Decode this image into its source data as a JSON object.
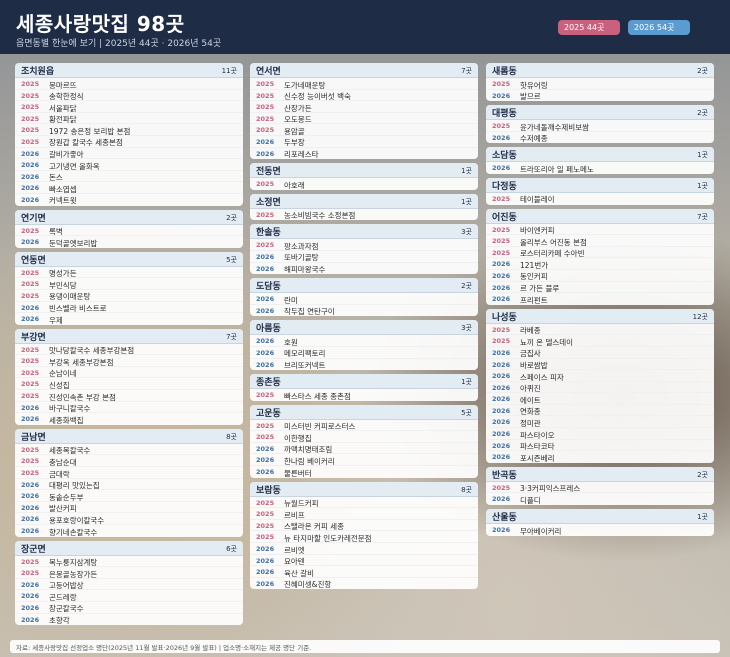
{
  "header": {
    "title": "세종사랑맛집 98곳",
    "subtitle": "읍면동별 한눈에 보기 | 2025년 44곳 · 2026년 54곳",
    "badge_2025": "2025 44곳",
    "badge_2026": "2026 54곳"
  },
  "colors": {
    "header_bg": "#1e2c45",
    "year_2025": "#c8607e",
    "year_2026": "#3d6fa6",
    "badge_2026": "#5b9bd0"
  },
  "columns": [
    [
      {
        "name": "조치원읍",
        "count": "11곳",
        "items": [
          {
            "year": "2025",
            "name": "몽마르뜨"
          },
          {
            "year": "2025",
            "name": "송학한정식"
          },
          {
            "year": "2025",
            "name": "서울파닭"
          },
          {
            "year": "2025",
            "name": "황전파닭"
          },
          {
            "year": "2025",
            "name": "1972 송은정 보리밥 본점"
          },
          {
            "year": "2025",
            "name": "장원갑 칼국수 세종본점"
          },
          {
            "year": "2026",
            "name": "갈비가좋아"
          },
          {
            "year": "2026",
            "name": "고기냉면 올화옥"
          },
          {
            "year": "2026",
            "name": "돈스"
          },
          {
            "year": "2026",
            "name": "빠소엽셉"
          },
          {
            "year": "2026",
            "name": "커넥트윗"
          }
        ]
      },
      {
        "name": "연기면",
        "count": "2곳",
        "items": [
          {
            "year": "2025",
            "name": "록벽"
          },
          {
            "year": "2026",
            "name": "둔덕골옛보리밥"
          }
        ]
      },
      {
        "name": "연동면",
        "count": "5곳",
        "items": [
          {
            "year": "2025",
            "name": "명성가든"
          },
          {
            "year": "2025",
            "name": "부민식당"
          },
          {
            "year": "2025",
            "name": "용댕이매운탕"
          },
          {
            "year": "2026",
            "name": "빈스벨라 비스트로"
          },
          {
            "year": "2026",
            "name": "우제"
          }
        ]
      },
      {
        "name": "부강면",
        "count": "7곳",
        "items": [
          {
            "year": "2025",
            "name": "맛나당칼국수 세종부강본점"
          },
          {
            "year": "2025",
            "name": "부강옥 세종부강본점"
          },
          {
            "year": "2025",
            "name": "순남이네"
          },
          {
            "year": "2025",
            "name": "신성집"
          },
          {
            "year": "2025",
            "name": "진성민속촌 부강 본점"
          },
          {
            "year": "2026",
            "name": "바구니칼국수"
          },
          {
            "year": "2026",
            "name": "세종화백집"
          }
        ]
      },
      {
        "name": "금남면",
        "count": "8곳",
        "items": [
          {
            "year": "2025",
            "name": "세종복칼국수"
          },
          {
            "year": "2025",
            "name": "충남순대"
          },
          {
            "year": "2025",
            "name": "금대락"
          },
          {
            "year": "2026",
            "name": "대평리 맛있는집"
          },
          {
            "year": "2026",
            "name": "동솥순두부"
          },
          {
            "year": "2026",
            "name": "발산커피"
          },
          {
            "year": "2026",
            "name": "용포호랑이칼국수"
          },
          {
            "year": "2026",
            "name": "향기네손칼국수"
          }
        ]
      },
      {
        "name": "장군면",
        "count": "6곳",
        "items": [
          {
            "year": "2025",
            "name": "복누룽지삼계탕"
          },
          {
            "year": "2025",
            "name": "은몽골농장가든"
          },
          {
            "year": "2026",
            "name": "고등어밥상"
          },
          {
            "year": "2026",
            "name": "곤드레랑"
          },
          {
            "year": "2026",
            "name": "장군칼국수"
          },
          {
            "year": "2026",
            "name": "초향각"
          }
        ]
      }
    ],
    [
      {
        "name": "연서면",
        "count": "7곳",
        "items": [
          {
            "year": "2025",
            "name": "도가네매운탕"
          },
          {
            "year": "2025",
            "name": "신수정 능이버섯 백숙"
          },
          {
            "year": "2025",
            "name": "산장가든"
          },
          {
            "year": "2025",
            "name": "오도몽드"
          },
          {
            "year": "2025",
            "name": "용암골"
          },
          {
            "year": "2026",
            "name": "두부장"
          },
          {
            "year": "2026",
            "name": "리포레스타"
          }
        ]
      },
      {
        "name": "전동면",
        "count": "1곳",
        "items": [
          {
            "year": "2025",
            "name": "아호래"
          }
        ]
      },
      {
        "name": "소정면",
        "count": "1곳",
        "items": [
          {
            "year": "2025",
            "name": "농소비빔국수 소정본점"
          }
        ]
      },
      {
        "name": "한솔동",
        "count": "3곳",
        "items": [
          {
            "year": "2025",
            "name": "팡소과자점"
          },
          {
            "year": "2026",
            "name": "또바기골탕"
          },
          {
            "year": "2026",
            "name": "해피마왕국수"
          }
        ]
      },
      {
        "name": "도담동",
        "count": "2곳",
        "items": [
          {
            "year": "2026",
            "name": "란미"
          },
          {
            "year": "2026",
            "name": "작두집 연탄구이"
          }
        ]
      },
      {
        "name": "아름동",
        "count": "3곳",
        "items": [
          {
            "year": "2026",
            "name": "호원"
          },
          {
            "year": "2026",
            "name": "메모리팩토리"
          },
          {
            "year": "2026",
            "name": "브리또커넥트"
          }
        ]
      },
      {
        "name": "종촌동",
        "count": "1곳",
        "items": [
          {
            "year": "2025",
            "name": "빠스타스 세종 종촌점"
          }
        ]
      },
      {
        "name": "고운동",
        "count": "5곳",
        "items": [
          {
            "year": "2025",
            "name": "미스터빈 커피로스터스"
          },
          {
            "year": "2025",
            "name": "이한행집"
          },
          {
            "year": "2026",
            "name": "까맥치명태조림"
          },
          {
            "year": "2026",
            "name": "한나림 베이커리"
          },
          {
            "year": "2026",
            "name": "물른버터"
          }
        ]
      },
      {
        "name": "보람동",
        "count": "8곳",
        "items": [
          {
            "year": "2025",
            "name": "뉴월드커피"
          },
          {
            "year": "2025",
            "name": "르비프"
          },
          {
            "year": "2025",
            "name": "스탤라온 커피 세종"
          },
          {
            "year": "2025",
            "name": "뉴 타지마할 인도카레전문점"
          },
          {
            "year": "2026",
            "name": "르비엣"
          },
          {
            "year": "2026",
            "name": "요아텐"
          },
          {
            "year": "2026",
            "name": "육산 갈비"
          },
          {
            "year": "2026",
            "name": "진혜미셍&진항"
          }
        ]
      }
    ],
    [
      {
        "name": "새롬동",
        "count": "2곳",
        "items": [
          {
            "year": "2025",
            "name": "핫유어링"
          },
          {
            "year": "2026",
            "name": "발므르"
          }
        ]
      },
      {
        "name": "대평동",
        "count": "2곳",
        "items": [
          {
            "year": "2025",
            "name": "윤가네돌깨수제비보쌈"
          },
          {
            "year": "2026",
            "name": "수저예종"
          }
        ]
      },
      {
        "name": "소담동",
        "count": "1곳",
        "items": [
          {
            "year": "2026",
            "name": "트라또리아 일 페노메노"
          }
        ]
      },
      {
        "name": "다정동",
        "count": "1곳",
        "items": [
          {
            "year": "2025",
            "name": "테이블레이"
          }
        ]
      },
      {
        "name": "어진동",
        "count": "7곳",
        "items": [
          {
            "year": "2025",
            "name": "바이엔커피"
          },
          {
            "year": "2025",
            "name": "올리부스 어진동 본점"
          },
          {
            "year": "2025",
            "name": "로스터리카페 수아빈"
          },
          {
            "year": "2026",
            "name": "121번가"
          },
          {
            "year": "2026",
            "name": "동인커피"
          },
          {
            "year": "2026",
            "name": "르 가든 블루"
          },
          {
            "year": "2026",
            "name": "프리펀트"
          }
        ]
      },
      {
        "name": "나성동",
        "count": "12곳",
        "items": [
          {
            "year": "2025",
            "name": "라베종"
          },
          {
            "year": "2025",
            "name": "뇨끼 온 델스데이"
          },
          {
            "year": "2026",
            "name": "금집사"
          },
          {
            "year": "2026",
            "name": "바로쌈밥"
          },
          {
            "year": "2026",
            "name": "스페이스 피자"
          },
          {
            "year": "2026",
            "name": "아퀴진"
          },
          {
            "year": "2026",
            "name": "에이트"
          },
          {
            "year": "2026",
            "name": "연화종"
          },
          {
            "year": "2026",
            "name": "정미관"
          },
          {
            "year": "2026",
            "name": "파스타이오"
          },
          {
            "year": "2026",
            "name": "파스타코타"
          },
          {
            "year": "2026",
            "name": "포시즌베리"
          }
        ]
      },
      {
        "name": "반곡동",
        "count": "2곳",
        "items": [
          {
            "year": "2025",
            "name": "3·3커피익스프레스"
          },
          {
            "year": "2026",
            "name": "디플디"
          }
        ]
      },
      {
        "name": "산울동",
        "count": "1곳",
        "items": [
          {
            "year": "2026",
            "name": "무아베이커리"
          }
        ]
      }
    ]
  ],
  "footer": {
    "text": "자료: 세종사랑맛집 선정업소 명단(2025년 11월 발표·2026년 9월 발표) | 업소명·소재지는 제공 명단 기준."
  }
}
